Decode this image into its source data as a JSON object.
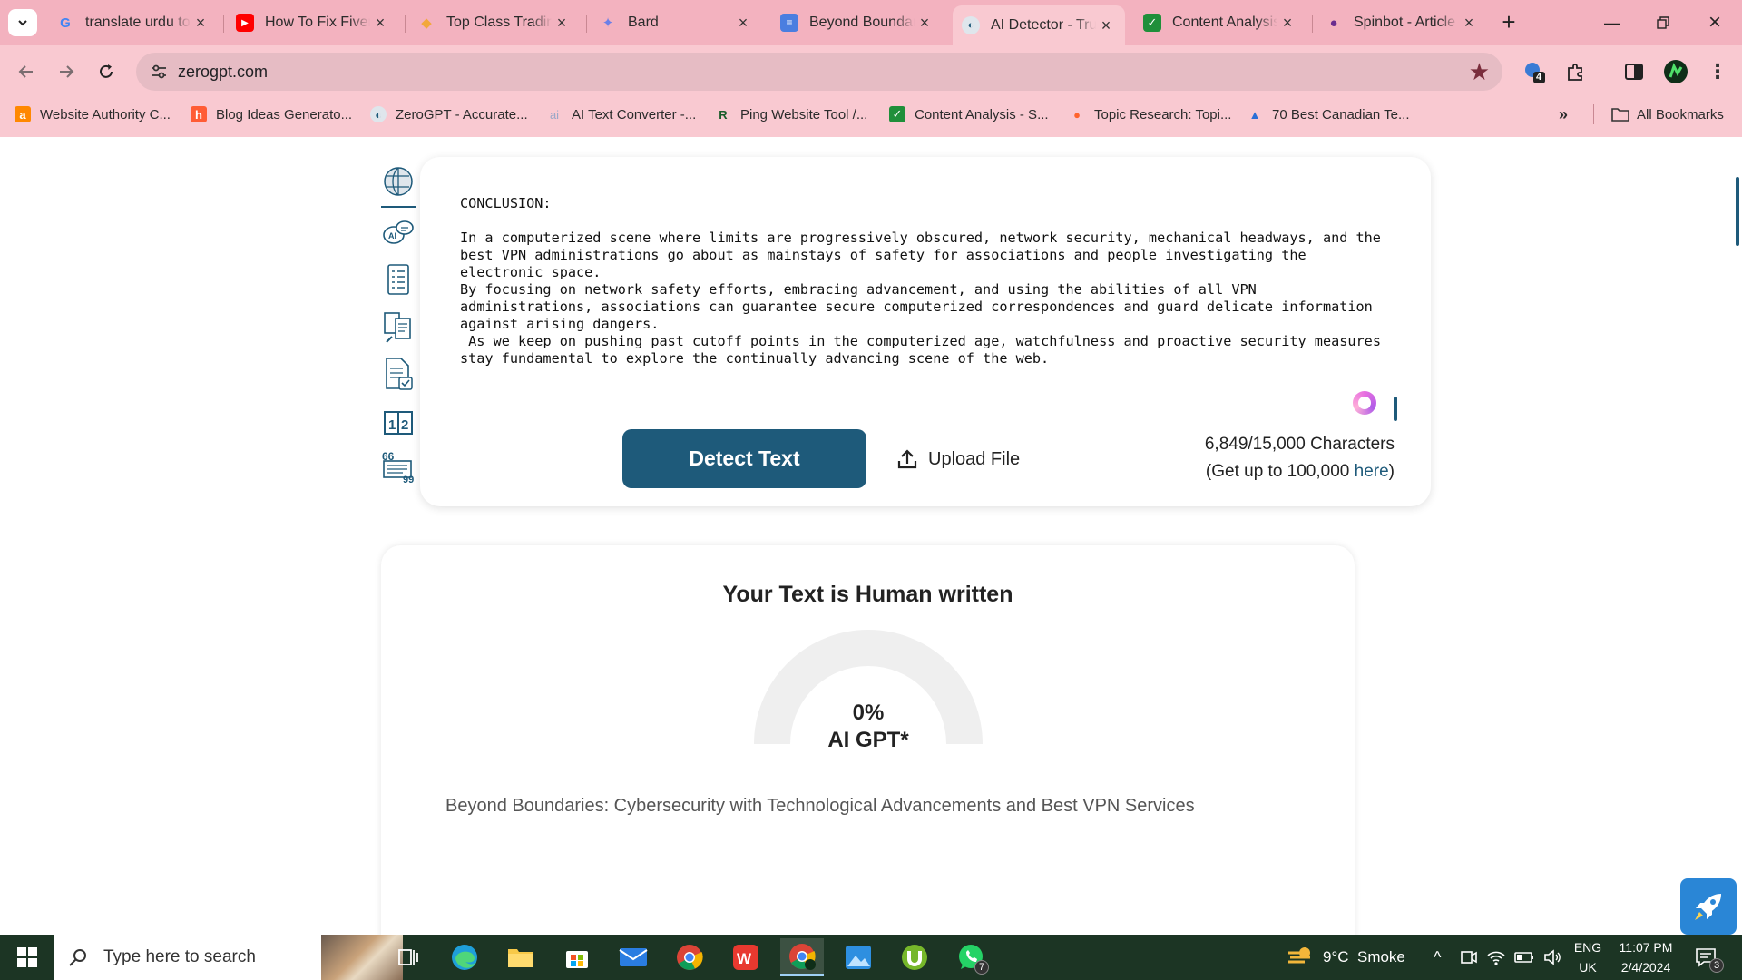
{
  "browser": {
    "tabs": [
      {
        "title": "translate urdu to",
        "icon": "google-icon",
        "active": false
      },
      {
        "title": "How To Fix Fiverr",
        "icon": "youtube-icon",
        "active": false
      },
      {
        "title": "Top Class Trading",
        "icon": "diamond-icon",
        "active": false
      },
      {
        "title": "Bard",
        "icon": "bard-sparkle-icon",
        "active": false
      },
      {
        "title": "Beyond Boundar",
        "icon": "docs-icon",
        "active": false
      },
      {
        "title": "AI Detector - Tru",
        "icon": "zerogpt-brain-icon",
        "active": true
      },
      {
        "title": "Content Analysis",
        "icon": "checkmark-icon",
        "active": false
      },
      {
        "title": "Spinbot - Article",
        "icon": "spinbot-icon",
        "active": false
      }
    ],
    "url": "zerogpt.com",
    "extension_badge": "4",
    "bookmarks": [
      {
        "label": "Website Authority C...",
        "icon": "ahrefs-icon"
      },
      {
        "label": "Blog Ideas Generato...",
        "icon": "hubspot-icon"
      },
      {
        "label": "ZeroGPT - Accurate...",
        "icon": "zerogpt-brain-icon"
      },
      {
        "label": "AI Text Converter -...",
        "icon": "ai-icon"
      },
      {
        "label": "Ping Website Tool /...",
        "icon": "ping-icon"
      },
      {
        "label": "Content Analysis - S...",
        "icon": "checkmark-icon"
      },
      {
        "label": "Topic Research: Topi...",
        "icon": "semrush-icon"
      },
      {
        "label": "70 Best Canadian Te...",
        "icon": "triangle-logo-icon"
      }
    ],
    "all_bookmarks_label": "All Bookmarks"
  },
  "editor": {
    "text": "CONCLUSION:\n\nIn a computerized scene where limits are progressively obscured, network security, mechanical headways, and the\nbest VPN administrations go about as mainstays of safety for associations and people investigating the\nelectronic space.\nBy focusing on network safety efforts, embracing advancement, and using the abilities of all VPN\nadministrations, associations can guarantee secure computerized correspondences and guard delicate information\nagainst arising dangers.\n As we keep on pushing past cutoff points in the computerized age, watchfulness and proactive security measures\nstay fundamental to explore the continually advancing scene of the web.",
    "detect_label": "Detect Text",
    "upload_label": "Upload File",
    "char_count": "6,849/15,000 Characters",
    "upgrade_prefix": "(Get up to 100,000 ",
    "upgrade_link": "here",
    "upgrade_suffix": ")"
  },
  "result": {
    "title": "Your Text is Human written",
    "percent_text": "0%",
    "percent_value": 0,
    "gauge_label": "AI GPT*",
    "heading": "Beyond Boundaries: Cybersecurity with Technological Advancements and Best VPN Services"
  },
  "colors": {
    "brand": "#1e5a7a",
    "tabstrip": "#f3b2bf",
    "toolbar": "#f9c9d1",
    "taskbar": "#1c3524"
  },
  "taskbar": {
    "search_placeholder": "Type here to search",
    "apps": [
      "task-view-icon",
      "edge-icon",
      "file-explorer-icon",
      "store-icon",
      "mail-icon",
      "chrome-icon",
      "wps-office-icon",
      "chrome-profile-icon",
      "photos-icon",
      "utorrent-icon",
      "whatsapp-icon"
    ],
    "whatsapp_badge": "7",
    "weather": "9°C  Smoke",
    "lang_top": "ENG",
    "lang_bottom": "UK",
    "time": "11:07 PM",
    "date": "2/4/2024",
    "notification_count": "3"
  }
}
